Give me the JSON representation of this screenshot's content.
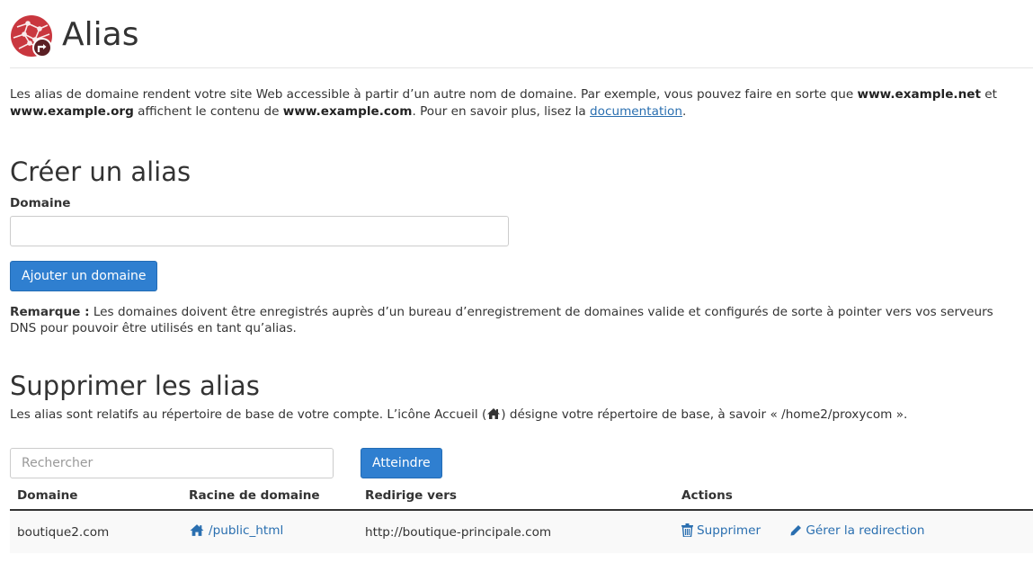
{
  "header": {
    "title": "Alias"
  },
  "intro": {
    "text_1": "Les alias de domaine rendent votre site Web accessible à partir d’un autre nom de domaine. Par exemple, vous pouvez faire en sorte que ",
    "example_net": "www.example.net",
    "text_2": " et",
    "example_org": "www.example.org",
    "text_3": " affichent le contenu de ",
    "example_com": "www.example.com",
    "text_4": ". Pour en savoir plus, lisez la ",
    "doc_link": "documentation",
    "text_5": "."
  },
  "create": {
    "title": "Créer un alias",
    "domain_label": "Domaine",
    "domain_value": "",
    "add_button": "Ajouter un domaine",
    "note_label": "Remarque :",
    "note_text": " Les domaines doivent être enregistrés auprès d’un bureau d’enregistrement de domaines valide et configurés de sorte à pointer vers vos serveurs DNS pour pouvoir être utilisés en tant qu’alias."
  },
  "delete": {
    "title": "Supprimer les alias",
    "desc_1": "Les alias sont relatifs au répertoire de base de votre compte. L’icône Accueil (",
    "desc_2": ") désigne votre répertoire de base, à savoir « /home2/proxycom »."
  },
  "search": {
    "placeholder": "Rechercher",
    "value": "",
    "go_button": "Atteindre"
  },
  "table": {
    "columns": [
      "Domaine",
      "Racine de domaine",
      "Redirige vers",
      "Actions"
    ],
    "rows": [
      {
        "domain": "boutique2.com",
        "docroot": "/public_html",
        "redirect": "http://boutique-principale.com",
        "delete_label": "Supprimer",
        "manage_label": "Gérer la redirection"
      }
    ]
  },
  "icons": {
    "logo": "globe-redirect-icon",
    "home": "home-icon",
    "trash": "trash-icon",
    "pencil": "pencil-icon"
  },
  "colors": {
    "accent": "#2f7fd0",
    "link": "#2a6fb0",
    "logo_red": "#c9373f"
  }
}
